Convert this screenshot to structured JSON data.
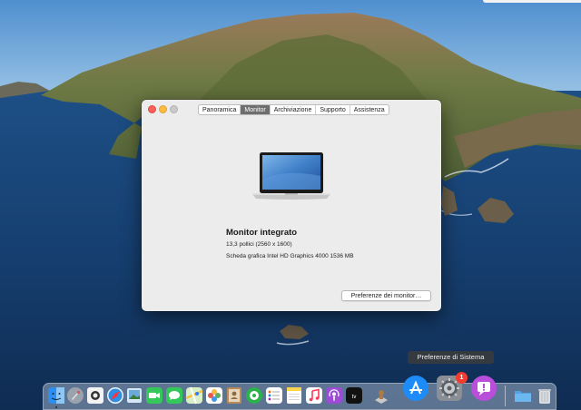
{
  "window": {
    "tabs": [
      {
        "label": "Panoramica",
        "active": false
      },
      {
        "label": "Monitor",
        "active": true
      },
      {
        "label": "Archiviazione",
        "active": false
      },
      {
        "label": "Supporto",
        "active": false
      },
      {
        "label": "Assistenza",
        "active": false
      }
    ],
    "monitor_title": "Monitor integrato",
    "size_spec": "13,3 pollici (2560 x 1600)",
    "gpu_spec": "Scheda grafica Intel HD Graphics 4000 1536 MB",
    "prefs_button": "Preferenze dei monitor…"
  },
  "tooltip": "Preferenze di Sistema",
  "dock": {
    "badge_count": "1",
    "apps": [
      "finder-icon",
      "launchpad-icon",
      "photo-booth-icon",
      "safari-icon",
      "preview-icon",
      "facetime-icon",
      "messages-icon",
      "maps-icon",
      "photos-icon",
      "contacts-icon",
      "calendar-icon",
      "notes-icon",
      "reminders-icon",
      "music-icon",
      "podcasts-icon",
      "apple-tv-icon",
      "script-editor-icon",
      "app-store-icon",
      "system-preferences-icon",
      "feedback-assistant-icon",
      "downloads-folder-icon",
      "trash-icon"
    ]
  },
  "colors": {
    "close": "#fc605b",
    "minimize": "#fdbc40",
    "zoom": "#c9c9c9",
    "active_tab": "#6e6e6e",
    "badge": "#f33b30"
  }
}
